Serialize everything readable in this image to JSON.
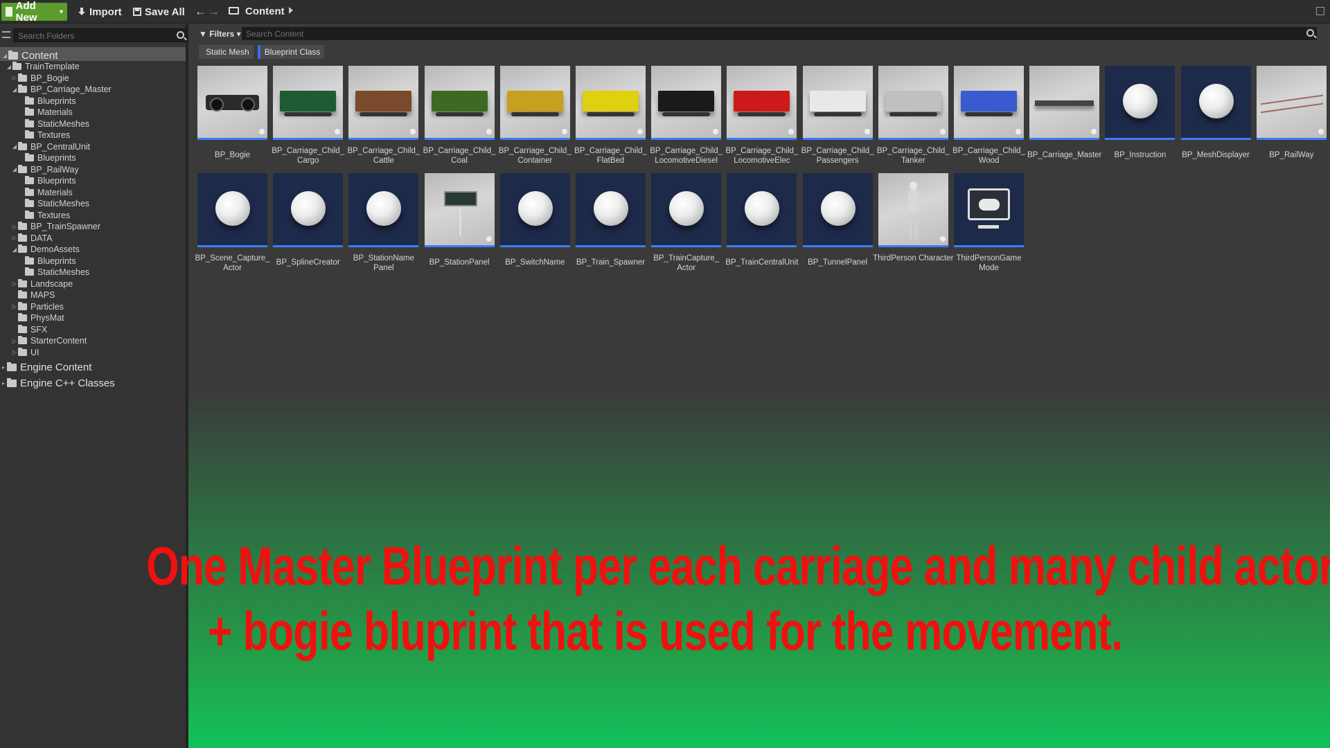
{
  "toolbar": {
    "add_new_label": "Add New",
    "import_label": "Import",
    "save_all_label": "Save All",
    "path_label": "Content"
  },
  "left_panel": {
    "search_placeholder": "Search Folders",
    "root_label": "Content",
    "tree": [
      {
        "label": "TrainTemplate",
        "indent": 1,
        "expanded": true
      },
      {
        "label": "BP_Bogie",
        "indent": 2,
        "expanded": false
      },
      {
        "label": "BP_Carriage_Master",
        "indent": 2,
        "expanded": true
      },
      {
        "label": "Blueprints",
        "indent": 3
      },
      {
        "label": "Materials",
        "indent": 3
      },
      {
        "label": "StaticMeshes",
        "indent": 3
      },
      {
        "label": "Textures",
        "indent": 3
      },
      {
        "label": "BP_CentralUnit",
        "indent": 2,
        "expanded": true
      },
      {
        "label": "Blueprints",
        "indent": 3
      },
      {
        "label": "BP_RailWay",
        "indent": 2,
        "expanded": true
      },
      {
        "label": "Blueprints",
        "indent": 3
      },
      {
        "label": "Materials",
        "indent": 3
      },
      {
        "label": "StaticMeshes",
        "indent": 3
      },
      {
        "label": "Textures",
        "indent": 3
      },
      {
        "label": "BP_TrainSpawner",
        "indent": 2,
        "expanded": false
      },
      {
        "label": "DATA",
        "indent": 2,
        "expanded": false
      },
      {
        "label": "DemoAssets",
        "indent": 2,
        "expanded": true
      },
      {
        "label": "Blueprints",
        "indent": 3
      },
      {
        "label": "StaticMeshes",
        "indent": 3
      },
      {
        "label": "Landscape",
        "indent": 2,
        "expanded": false
      },
      {
        "label": "MAPS",
        "indent": 2
      },
      {
        "label": "Particles",
        "indent": 2,
        "expanded": false
      },
      {
        "label": "PhysMat",
        "indent": 2
      },
      {
        "label": "SFX",
        "indent": 2
      },
      {
        "label": "StarterContent",
        "indent": 2,
        "expanded": false
      },
      {
        "label": "UI",
        "indent": 2,
        "expanded": false
      }
    ],
    "engine_content_label": "Engine Content",
    "engine_cpp_label": "Engine C++ Classes"
  },
  "content": {
    "filters_label": "Filters",
    "search_placeholder": "Search Content",
    "chips": [
      {
        "label": "Static Mesh"
      },
      {
        "label": "Blueprint Class"
      }
    ],
    "assets_row1": [
      {
        "name": "BP_Bogie",
        "thumb": "bogie"
      },
      {
        "name": "BP_Carriage_Child_ Cargo",
        "thumb": "car",
        "color": "#1e5a32"
      },
      {
        "name": "BP_Carriage_Child_ Cattle",
        "thumb": "car",
        "color": "#7a4a2a"
      },
      {
        "name": "BP_Carriage_Child_ Coal",
        "thumb": "car",
        "color": "#3c6a22"
      },
      {
        "name": "BP_Carriage_Child_ Container",
        "thumb": "car",
        "color": "#c8a020"
      },
      {
        "name": "BP_Carriage_Child_ FlatBed",
        "thumb": "car",
        "color": "#e0d010"
      },
      {
        "name": "BP_Carriage_Child_ LocomotiveDiesel",
        "thumb": "car",
        "color": "#1a1a1a"
      },
      {
        "name": "BP_Carriage_Child_ LocomotiveElec",
        "thumb": "car",
        "color": "#cc1a1a"
      },
      {
        "name": "BP_Carriage_Child_ Passengers",
        "thumb": "car",
        "color": "#e8e8e8"
      },
      {
        "name": "BP_Carriage_Child_ Tanker",
        "thumb": "car",
        "color": "#c0c0c0"
      },
      {
        "name": "BP_Carriage_Child_ Wood",
        "thumb": "car",
        "color": "#3a5ad0"
      },
      {
        "name": "BP_Carriage_Master",
        "thumb": "flat"
      },
      {
        "name": "BP_Instruction",
        "thumb": "sphere"
      },
      {
        "name": "BP_MeshDisplayer",
        "thumb": "sphere"
      },
      {
        "name": "BP_RailWay",
        "thumb": "rails"
      }
    ],
    "assets_row2": [
      {
        "name": "BP_Scene_Capture_ Actor",
        "thumb": "sphere"
      },
      {
        "name": "BP_SplineCreator",
        "thumb": "sphere"
      },
      {
        "name": "BP_StationName Panel",
        "thumb": "sphere"
      },
      {
        "name": "BP_StationPanel",
        "thumb": "panel"
      },
      {
        "name": "BP_SwitchName",
        "thumb": "sphere"
      },
      {
        "name": "BP_Train_Spawner",
        "thumb": "sphere"
      },
      {
        "name": "BP_TrainCapture_ Actor",
        "thumb": "sphere"
      },
      {
        "name": "BP_TrainCentralUnit",
        "thumb": "sphere"
      },
      {
        "name": "BP_TunnelPanel",
        "thumb": "sphere"
      },
      {
        "name": "ThirdPerson Character",
        "thumb": "figure"
      },
      {
        "name": "ThirdPersonGame Mode",
        "thumb": "gamepad"
      }
    ]
  },
  "caption": {
    "line1": "One Master Blueprint per each carriage and many child actors",
    "line2": "+ bogie bluprint that is used for the movement."
  },
  "colors": {
    "accent_blue": "#3c7cff",
    "add_new_green": "#5c9c2c",
    "caption_red": "#f01010",
    "bg_green": "#10c25c"
  }
}
